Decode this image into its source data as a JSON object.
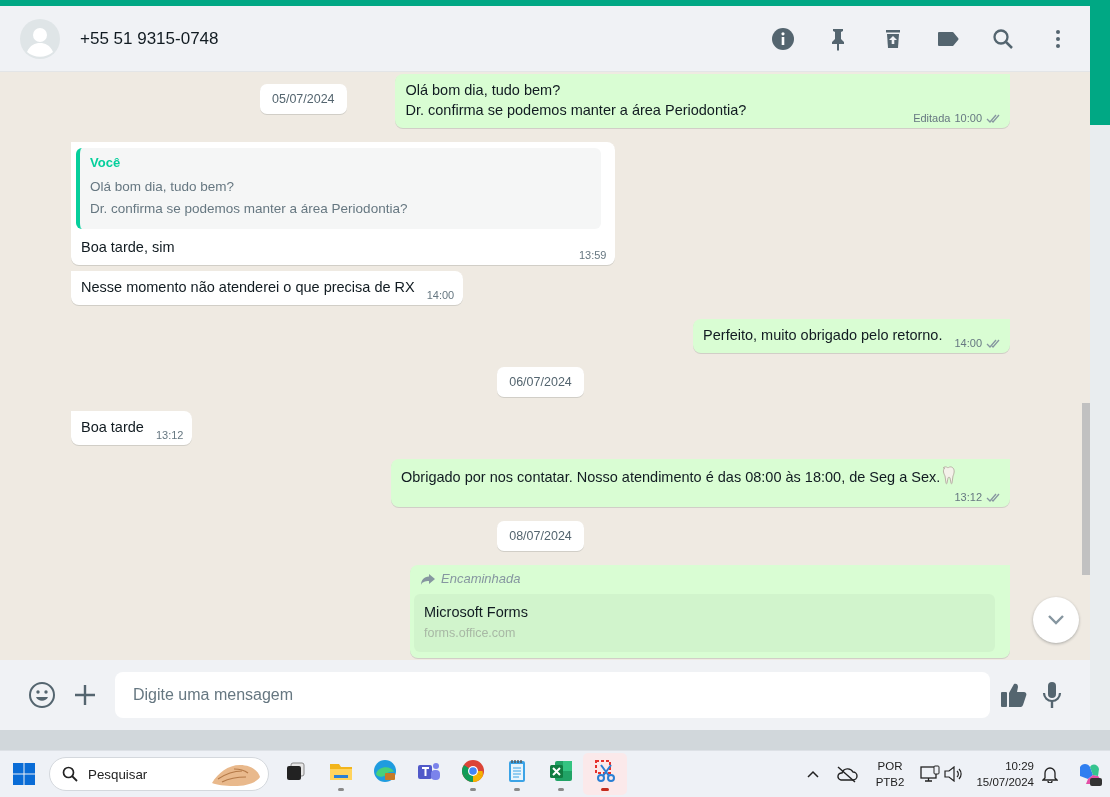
{
  "header": {
    "contact": "+55 51 9315-0748"
  },
  "sticky_date": "05/07/2024",
  "items": [
    {
      "kind": "outgoing",
      "text": "Dr. confirma se podemos manter a área Periodontia?",
      "cut_line": "Olá bom dia, tudo bem?",
      "edited": "Editada",
      "time": "10:00",
      "read": false
    },
    {
      "kind": "incoming",
      "quote": {
        "author": "Você",
        "lines": [
          "Olá bom dia, tudo bem?",
          "Dr. confirma se podemos manter a área Periodontia?"
        ]
      },
      "text": "Boa tarde, sim",
      "time": "13:59"
    },
    {
      "kind": "incoming",
      "text": "Nesse momento não atenderei o que precisa de RX",
      "time": "14:00"
    },
    {
      "kind": "outgoing",
      "text": "Perfeito, muito obrigado pelo retorno.",
      "time": "14:00",
      "read": false
    },
    {
      "kind": "date",
      "text": "06/07/2024"
    },
    {
      "kind": "incoming",
      "text": "Boa tarde",
      "time": "13:12"
    },
    {
      "kind": "outgoing",
      "text": "Obrigado por nos contatar. Nosso atendimento é das 08:00 às 18:00, de Seg a Sex.",
      "tooth": true,
      "time": "13:12",
      "read": false
    },
    {
      "kind": "date",
      "text": "08/07/2024"
    },
    {
      "kind": "forwarded",
      "label": "Encaminhada",
      "link": {
        "title": "Microsoft Forms",
        "url": "forms.office.com"
      }
    }
  ],
  "composer": {
    "placeholder": "Digite uma mensagem"
  },
  "taskbar": {
    "search": {
      "placeholder": "Pesquisar"
    },
    "apps": [
      {
        "kind": "taskview",
        "running": false,
        "active": false
      },
      {
        "kind": "folder",
        "running": true,
        "active": false
      },
      {
        "kind": "edge",
        "running": false,
        "active": false
      },
      {
        "kind": "teams",
        "running": false,
        "active": false
      },
      {
        "kind": "chrome",
        "running": true,
        "active": false
      },
      {
        "kind": "notepad",
        "running": true,
        "active": false
      },
      {
        "kind": "excel",
        "running": true,
        "active": false
      },
      {
        "kind": "snip",
        "running": true,
        "active": true
      }
    ],
    "language": "POR",
    "layout": "PTB2",
    "time": "10:29",
    "date": "15/07/2024"
  }
}
